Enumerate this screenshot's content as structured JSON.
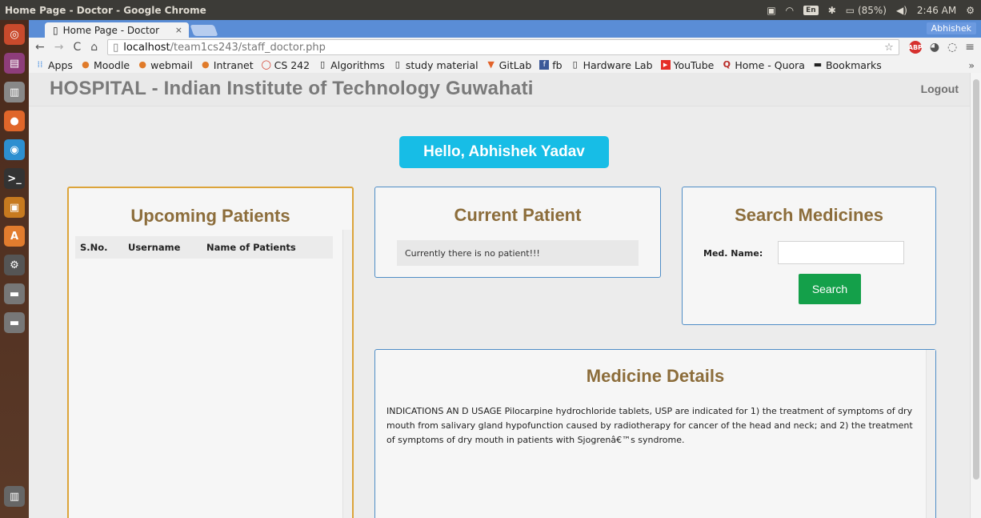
{
  "os": {
    "window_title": "Home Page - Doctor - Google Chrome",
    "tray": {
      "keyboard": "En",
      "battery": "(85%)",
      "time": "2:46 AM"
    }
  },
  "browser": {
    "tab_title": "Home Page - Doctor",
    "tab_close": "×",
    "profile": "Abhishek",
    "url_host": "localhost",
    "url_path": "/team1cs243/staff_doctor.php",
    "bookmarks": [
      "Apps",
      "Moodle",
      "webmail",
      "Intranet",
      "CS 242",
      "Algorithms",
      "study material",
      "GitLab",
      "fb",
      "Hardware Lab",
      "YouTube",
      "Home - Quora",
      "Bookmarks"
    ],
    "bookmarks_more": "»"
  },
  "page": {
    "brand": "HOSPITAL - Indian Institute of Technology Guwahati",
    "logout": "Logout",
    "greeting": "Hello, Abhishek Yadav",
    "upcoming": {
      "title": "Upcoming Patients",
      "columns": [
        "S.No.",
        "Username",
        "Name of Patients"
      ]
    },
    "current": {
      "title": "Current Patient",
      "message": "Currently there is no patient!!!"
    },
    "search": {
      "title": "Search Medicines",
      "label": "Med. Name:",
      "input_value": "",
      "button": "Search"
    },
    "details": {
      "title": "Medicine Details",
      "text": "INDICATIONS AN D USAGE Pilocarpine hydrochloride tablets, USP are indicated for 1) the treatment of symptoms of dry mouth from salivary gland hypofunction caused by radiotherapy for cancer of the head and neck; and 2) the treatment of symptoms of dry mouth in patients with Sjogrenâ€™s syndrome."
    }
  },
  "colors": {
    "accent_title": "#8c6d3b",
    "greeting_bg": "#17bde6",
    "search_button": "#14a04a",
    "upcoming_border": "#dca43a",
    "card_border": "#4f8dc6"
  }
}
